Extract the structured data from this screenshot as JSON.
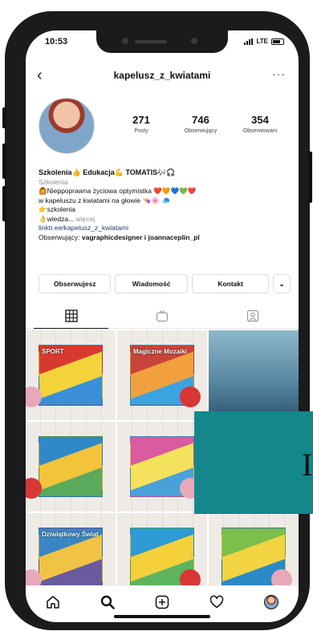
{
  "status": {
    "time": "10:53",
    "carrier": "LTE"
  },
  "header": {
    "username": "kapelusz_z_kwiatami",
    "back_icon": "chevron-left-icon",
    "more_icon": "more-horizontal-icon"
  },
  "profile": {
    "stats": [
      {
        "value": "271",
        "label": "Posty"
      },
      {
        "value": "746",
        "label": "Obserwujący"
      },
      {
        "value": "354",
        "label": "Obserwowani"
      }
    ],
    "bio": {
      "name": "Szkolenia👍 Edukacja💪 TOMATIS🎶🎧",
      "category": "Szkolenia",
      "line1": "🙆Nieppoprawna życiowa optymistka ❤️🧡💙💚❤️",
      "line2": "w kapeluszu z kwiatami na głowie 👒🌸 🧢",
      "line3": "👉szkolenia",
      "line4": "👌wiedza...",
      "more": "więcej",
      "link": "linktr.ee/kapelusz_z_kwiatami",
      "followed_prefix": "Obserwujący: ",
      "followed_names": "vagraphicdesigner i joannaceplin_pl"
    },
    "buttons": {
      "follow": "Obserwujesz",
      "message": "Wiadomość",
      "contact": "Kontakt",
      "chevron": "⌄"
    }
  },
  "tabs": [
    {
      "icon": "grid-icon",
      "active": true
    },
    {
      "icon": "igtv-icon",
      "active": false
    },
    {
      "icon": "tagged-icon",
      "active": false
    }
  ],
  "posts": [
    {
      "label": "SPORT",
      "palette": [
        "#d63a2f",
        "#f3d23a",
        "#3a8fd6"
      ]
    },
    {
      "label": "Magiczne Mozaiki",
      "palette": [
        "#c8443b",
        "#f2a03d",
        "#3aa3e0"
      ]
    },
    {
      "label": "",
      "palette": [
        "#8db7c9",
        "#5b8aa3",
        "#2d5570"
      ]
    },
    {
      "label": "",
      "palette": [
        "#2f89c9",
        "#f3c33a",
        "#5aa95c"
      ]
    },
    {
      "label": "",
      "palette": [
        "#d95ba0",
        "#f5e25c",
        "#4aa0d8"
      ]
    },
    {
      "label": "",
      "palette": [
        "#e9e6df",
        "#cfccc5",
        "#bdbab2"
      ]
    },
    {
      "label": "Dziwiątkowy Świat",
      "palette": [
        "#3a86c4",
        "#f0c344",
        "#6a5a9e"
      ]
    },
    {
      "label": "",
      "palette": [
        "#2e9bd3",
        "#f4d03a",
        "#5eb35e"
      ]
    },
    {
      "label": "",
      "palette": [
        "#7cbf4a",
        "#f2d443",
        "#2b8ac6"
      ]
    }
  ],
  "overlay": {
    "letter": "I",
    "color": "#15878b"
  },
  "bottom_nav": [
    "home-icon",
    "search-icon",
    "new-post-icon",
    "activity-heart-icon",
    "profile-avatar"
  ]
}
